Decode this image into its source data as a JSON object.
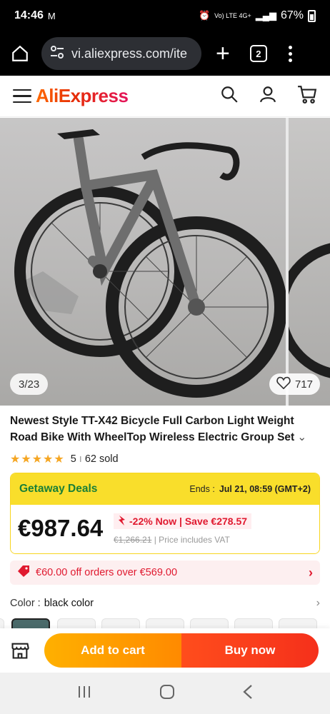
{
  "status": {
    "time": "14:46",
    "mail_icon": "gmail-icon",
    "net_label": "Vo) LTE 4G+",
    "battery": "67%"
  },
  "browser": {
    "url": "vi.aliexpress.com/ite",
    "tab_count": "2"
  },
  "app": {
    "logo": "AliExpress"
  },
  "gallery": {
    "counter": "3/23",
    "likes": "717"
  },
  "product": {
    "title": "Newest Style TT-X42 Bicycle Full Carbon Light Weight Road Bike With WheelTop Wireless Electric Group Set",
    "rating": "5",
    "sep": "ı",
    "sold": "62 sold"
  },
  "deal": {
    "name": "Getaway Deals",
    "ends_label": "Ends :",
    "ends_value": "Jul 21, 08:59 (GMT+2)",
    "price": "€987.64",
    "discount": "-22% Now | Save €278.57",
    "old_price": "€1,266.21",
    "vat": "| Price includes VAT"
  },
  "coupon": {
    "text": "€60.00 off orders over €569.00"
  },
  "color": {
    "label": "Color :",
    "value": "black color"
  },
  "actions": {
    "add_to_cart": "Add to cart",
    "buy_now": "Buy now"
  },
  "colors": {
    "brand": "#e62e04",
    "deal_yellow": "#f9de2b",
    "deal_green": "#1a7f37",
    "cart": "#ff9a00",
    "buy": "#f5301b"
  }
}
